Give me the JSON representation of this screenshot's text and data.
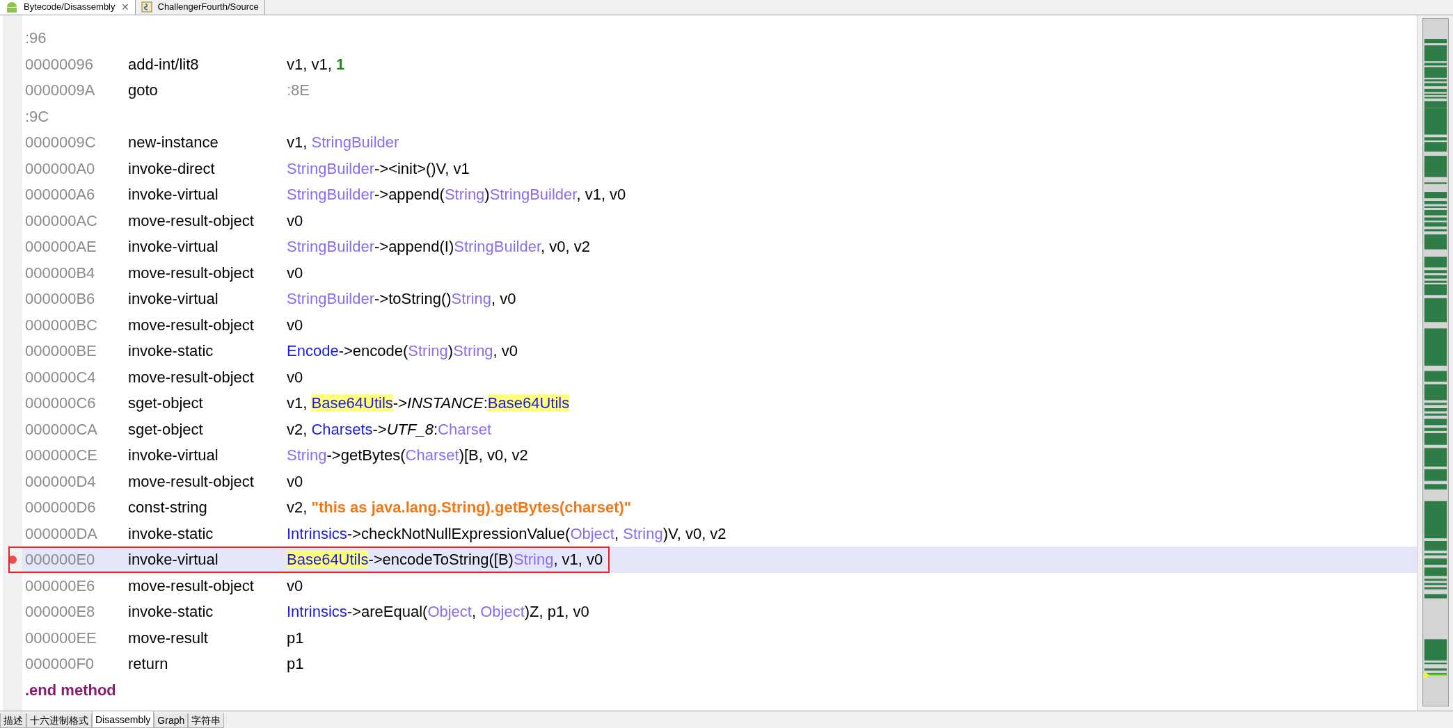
{
  "editor_tabs": [
    {
      "label": "Bytecode/Disassembly",
      "selected": true,
      "close_glyph": "✕"
    },
    {
      "label": "ChallengerFourth/Source",
      "selected": false
    }
  ],
  "lines": [
    {
      "kind": "label",
      "address": ":96",
      "selected": false,
      "breakpoint": false,
      "boxed": false
    },
    {
      "kind": "instruction",
      "address": "00000096",
      "opcode": "add-int/lit8",
      "selected": false,
      "breakpoint": false,
      "boxed": false,
      "operands": [
        {
          "kind": "plain",
          "text": "v1, v1, "
        },
        {
          "kind": "number",
          "text": "1"
        }
      ]
    },
    {
      "kind": "instruction",
      "address": "0000009A",
      "opcode": "goto",
      "selected": false,
      "breakpoint": false,
      "boxed": false,
      "operands": [
        {
          "kind": "label",
          "text": ":8E"
        }
      ]
    },
    {
      "kind": "label",
      "address": ":9C",
      "selected": false,
      "breakpoint": false,
      "boxed": false
    },
    {
      "kind": "instruction",
      "address": "0000009C",
      "opcode": "new-instance",
      "selected": false,
      "breakpoint": false,
      "boxed": false,
      "operands": [
        {
          "kind": "plain",
          "text": "v1, "
        },
        {
          "kind": "type",
          "text": "StringBuilder"
        }
      ]
    },
    {
      "kind": "instruction",
      "address": "000000A0",
      "opcode": "invoke-direct",
      "selected": false,
      "breakpoint": false,
      "boxed": false,
      "operands": [
        {
          "kind": "type",
          "text": "StringBuilder"
        },
        {
          "kind": "plain",
          "text": "-><init>()V, v1"
        }
      ]
    },
    {
      "kind": "instruction",
      "address": "000000A6",
      "opcode": "invoke-virtual",
      "selected": false,
      "breakpoint": false,
      "boxed": false,
      "operands": [
        {
          "kind": "type",
          "text": "StringBuilder"
        },
        {
          "kind": "plain",
          "text": "->append("
        },
        {
          "kind": "type",
          "text": "String"
        },
        {
          "kind": "plain",
          "text": ")"
        },
        {
          "kind": "type",
          "text": "StringBuilder"
        },
        {
          "kind": "plain",
          "text": ", v1, v0"
        }
      ]
    },
    {
      "kind": "instruction",
      "address": "000000AC",
      "opcode": "move-result-object",
      "selected": false,
      "breakpoint": false,
      "boxed": false,
      "operands": [
        {
          "kind": "plain",
          "text": "v0"
        }
      ]
    },
    {
      "kind": "instruction",
      "address": "000000AE",
      "opcode": "invoke-virtual",
      "selected": false,
      "breakpoint": false,
      "boxed": false,
      "operands": [
        {
          "kind": "type",
          "text": "StringBuilder"
        },
        {
          "kind": "plain",
          "text": "->append(I)"
        },
        {
          "kind": "type",
          "text": "StringBuilder"
        },
        {
          "kind": "plain",
          "text": ", v0, v2"
        }
      ]
    },
    {
      "kind": "instruction",
      "address": "000000B4",
      "opcode": "move-result-object",
      "selected": false,
      "breakpoint": false,
      "boxed": false,
      "operands": [
        {
          "kind": "plain",
          "text": "v0"
        }
      ]
    },
    {
      "kind": "instruction",
      "address": "000000B6",
      "opcode": "invoke-virtual",
      "selected": false,
      "breakpoint": false,
      "boxed": false,
      "operands": [
        {
          "kind": "type",
          "text": "StringBuilder"
        },
        {
          "kind": "plain",
          "text": "->toString()"
        },
        {
          "kind": "type",
          "text": "String"
        },
        {
          "kind": "plain",
          "text": ", v0"
        }
      ]
    },
    {
      "kind": "instruction",
      "address": "000000BC",
      "opcode": "move-result-object",
      "selected": false,
      "breakpoint": false,
      "boxed": false,
      "operands": [
        {
          "kind": "plain",
          "text": "v0"
        }
      ]
    },
    {
      "kind": "instruction",
      "address": "000000BE",
      "opcode": "invoke-static",
      "selected": false,
      "breakpoint": false,
      "boxed": false,
      "operands": [
        {
          "kind": "class",
          "text": "Encode"
        },
        {
          "kind": "plain",
          "text": "->encode("
        },
        {
          "kind": "type",
          "text": "String"
        },
        {
          "kind": "plain",
          "text": ")"
        },
        {
          "kind": "type",
          "text": "String"
        },
        {
          "kind": "plain",
          "text": ", v0"
        }
      ]
    },
    {
      "kind": "instruction",
      "address": "000000C4",
      "opcode": "move-result-object",
      "selected": false,
      "breakpoint": false,
      "boxed": false,
      "operands": [
        {
          "kind": "plain",
          "text": "v0"
        }
      ]
    },
    {
      "kind": "instruction",
      "address": "000000C6",
      "opcode": "sget-object",
      "selected": false,
      "breakpoint": false,
      "boxed": false,
      "operands": [
        {
          "kind": "plain",
          "text": "v1, "
        },
        {
          "kind": "class-marked",
          "text": "Base64Utils"
        },
        {
          "kind": "plain",
          "text": "->"
        },
        {
          "kind": "field",
          "text": "INSTANCE"
        },
        {
          "kind": "plain",
          "text": ":"
        },
        {
          "kind": "class-marked",
          "text": "Base64Utils"
        }
      ]
    },
    {
      "kind": "instruction",
      "address": "000000CA",
      "opcode": "sget-object",
      "selected": false,
      "breakpoint": false,
      "boxed": false,
      "operands": [
        {
          "kind": "plain",
          "text": "v2, "
        },
        {
          "kind": "class",
          "text": "Charsets"
        },
        {
          "kind": "plain",
          "text": "->"
        },
        {
          "kind": "field",
          "text": "UTF_8"
        },
        {
          "kind": "plain",
          "text": ":"
        },
        {
          "kind": "type",
          "text": "Charset"
        }
      ]
    },
    {
      "kind": "instruction",
      "address": "000000CE",
      "opcode": "invoke-virtual",
      "selected": false,
      "breakpoint": false,
      "boxed": false,
      "operands": [
        {
          "kind": "type",
          "text": "String"
        },
        {
          "kind": "plain",
          "text": "->getBytes("
        },
        {
          "kind": "type",
          "text": "Charset"
        },
        {
          "kind": "plain",
          "text": ")[B, v0, v2"
        }
      ]
    },
    {
      "kind": "instruction",
      "address": "000000D4",
      "opcode": "move-result-object",
      "selected": false,
      "breakpoint": false,
      "boxed": false,
      "operands": [
        {
          "kind": "plain",
          "text": "v0"
        }
      ]
    },
    {
      "kind": "instruction",
      "address": "000000D6",
      "opcode": "const-string",
      "selected": false,
      "breakpoint": false,
      "boxed": false,
      "operands": [
        {
          "kind": "plain",
          "text": "v2, "
        },
        {
          "kind": "string",
          "text": "\"this as java.lang.String).getBytes(charset)\""
        }
      ]
    },
    {
      "kind": "instruction",
      "address": "000000DA",
      "opcode": "invoke-static",
      "selected": false,
      "breakpoint": false,
      "boxed": false,
      "operands": [
        {
          "kind": "class",
          "text": "Intrinsics"
        },
        {
          "kind": "plain",
          "text": "->checkNotNullExpressionValue("
        },
        {
          "kind": "type",
          "text": "Object"
        },
        {
          "kind": "plain",
          "text": ", "
        },
        {
          "kind": "type",
          "text": "String"
        },
        {
          "kind": "plain",
          "text": ")V, v0, v2"
        }
      ]
    },
    {
      "kind": "instruction",
      "address": "000000E0",
      "opcode": "invoke-virtual",
      "selected": true,
      "breakpoint": true,
      "boxed": true,
      "operands": [
        {
          "kind": "class-marked",
          "text": "Base64Utils"
        },
        {
          "kind": "plain",
          "text": "->encodeToString([B)"
        },
        {
          "kind": "type",
          "text": "String"
        },
        {
          "kind": "plain",
          "text": ", v1, v0"
        }
      ]
    },
    {
      "kind": "instruction",
      "address": "000000E6",
      "opcode": "move-result-object",
      "selected": false,
      "breakpoint": false,
      "boxed": false,
      "operands": [
        {
          "kind": "plain",
          "text": "v0"
        }
      ]
    },
    {
      "kind": "instruction",
      "address": "000000E8",
      "opcode": "invoke-static",
      "selected": false,
      "breakpoint": false,
      "boxed": false,
      "operands": [
        {
          "kind": "class",
          "text": "Intrinsics"
        },
        {
          "kind": "plain",
          "text": "->areEqual("
        },
        {
          "kind": "type",
          "text": "Object"
        },
        {
          "kind": "plain",
          "text": ", "
        },
        {
          "kind": "type",
          "text": "Object"
        },
        {
          "kind": "plain",
          "text": ")Z, p1, v0"
        }
      ]
    },
    {
      "kind": "instruction",
      "address": "000000EE",
      "opcode": "move-result",
      "selected": false,
      "breakpoint": false,
      "boxed": false,
      "operands": [
        {
          "kind": "plain",
          "text": "p1"
        }
      ]
    },
    {
      "kind": "instruction",
      "address": "000000F0",
      "opcode": "return",
      "selected": false,
      "breakpoint": false,
      "boxed": false,
      "operands": [
        {
          "kind": "plain",
          "text": "p1"
        }
      ]
    },
    {
      "kind": "directive",
      "address": ".end method",
      "selected": false,
      "breakpoint": false,
      "boxed": false
    }
  ],
  "bottom_tabs": [
    {
      "label": "描述",
      "selected": false
    },
    {
      "label": "十六进制格式",
      "selected": false
    },
    {
      "label": "Disassembly",
      "selected": true
    },
    {
      "label": "Graph",
      "selected": false
    },
    {
      "label": "字符串",
      "selected": false
    }
  ]
}
